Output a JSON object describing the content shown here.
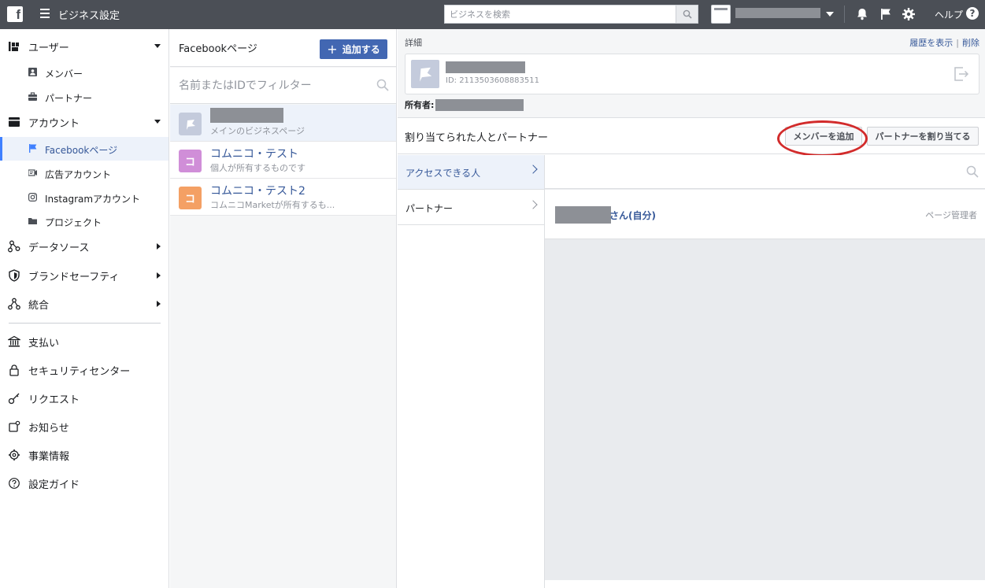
{
  "topbar": {
    "logo": "f",
    "title": "ビジネス設定",
    "search_placeholder": "ビジネスを検索",
    "help_label": "ヘルプ",
    "help_icon_glyph": "?"
  },
  "sidebar": {
    "sections": [
      {
        "label": "ユーザー",
        "icon": "users-icon",
        "children": [
          {
            "label": "メンバー",
            "icon": "person-badge-icon"
          },
          {
            "label": "パートナー",
            "icon": "briefcase-icon"
          }
        ]
      },
      {
        "label": "アカウント",
        "icon": "account-icon",
        "children": [
          {
            "label": "Facebookページ",
            "icon": "flag-icon",
            "active": true
          },
          {
            "label": "広告アカウント",
            "icon": "ad-account-icon"
          },
          {
            "label": "Instagramアカウント",
            "icon": "instagram-icon"
          },
          {
            "label": "プロジェクト",
            "icon": "folder-icon"
          }
        ]
      },
      {
        "label": "データソース",
        "icon": "data-source-icon"
      },
      {
        "label": "ブランドセーフティ",
        "icon": "shield-icon"
      },
      {
        "label": "統合",
        "icon": "integration-icon"
      }
    ],
    "bottom_items": [
      {
        "label": "支払い",
        "icon": "bank-icon"
      },
      {
        "label": "セキュリティセンター",
        "icon": "lock-icon"
      },
      {
        "label": "リクエスト",
        "icon": "key-icon"
      },
      {
        "label": "お知らせ",
        "icon": "notification-icon"
      },
      {
        "label": "事業情報",
        "icon": "gear-icon"
      },
      {
        "label": "設定ガイド",
        "icon": "question-icon"
      }
    ]
  },
  "pages_column": {
    "title": "Facebookページ",
    "add_button_label": "追加する",
    "filter_placeholder": "名前またはIDでフィルター",
    "pages": [
      {
        "name": "",
        "subtitle": "メインのビジネスページ",
        "thumb_color": "#c4cbdc",
        "thumb_text": "",
        "active": true
      },
      {
        "name": "コムニコ・テスト",
        "subtitle": "個人が所有するものです",
        "thumb_color": "#d08ed8",
        "thumb_text": "コ",
        "active": false
      },
      {
        "name": "コムニコ・テスト2",
        "subtitle": "コムニコMarketが所有するも...",
        "thumb_color": "#f4a064",
        "thumb_text": "コ",
        "active": false
      }
    ]
  },
  "detail": {
    "section_label": "詳細",
    "history_link": "履歴を表示",
    "delete_link": "削除",
    "page_id": "ID: 2113503608883511",
    "owner_label": "所有者:",
    "assigned_title": "割り当てられた人とパートナー",
    "add_member_button": "メンバーを追加",
    "assign_partner_button": "パートナーを割り当てる",
    "tabs": [
      {
        "label": "アクセスできる人",
        "active": true
      },
      {
        "label": "パートナー",
        "active": false
      }
    ],
    "member": {
      "name_suffix": "さん(自分)",
      "role": "ページ管理者"
    }
  },
  "colors": {
    "topbar": "#4b4f56",
    "primary": "#4267b2",
    "link": "#365899",
    "active_bg": "#edf2fa",
    "annotation": "#d22b2b"
  }
}
